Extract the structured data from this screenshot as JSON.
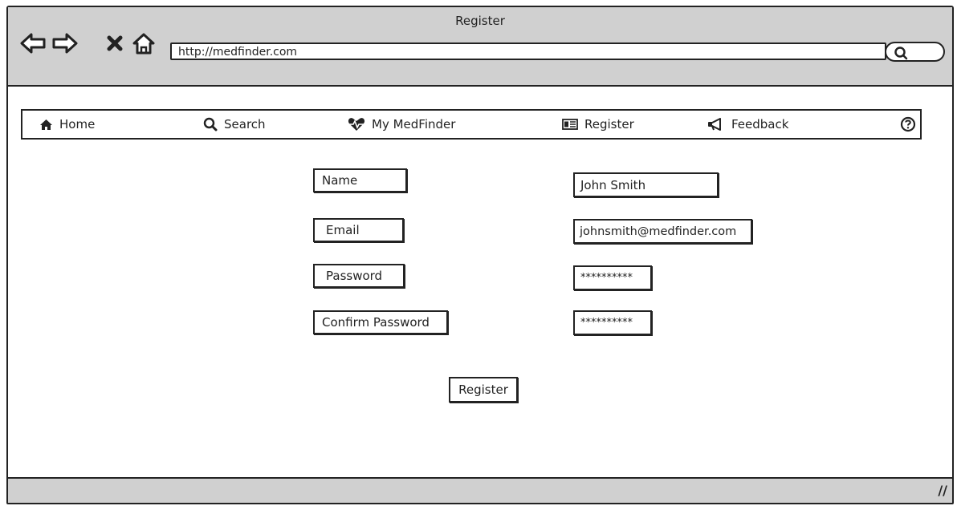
{
  "window": {
    "title": "Register"
  },
  "browser": {
    "url": "http://medfinder.com",
    "icons": [
      "back-arrow-icon",
      "forward-arrow-icon",
      "stop-icon",
      "home-icon",
      "search-icon"
    ]
  },
  "menu": {
    "items": [
      {
        "label": "Home",
        "icon": "home-icon"
      },
      {
        "label": "Search",
        "icon": "search-icon"
      },
      {
        "label": "My MedFinder",
        "icon": "heartbeat-icon"
      },
      {
        "label": "Register",
        "icon": "id-card-icon"
      },
      {
        "label": "Feedback",
        "icon": "megaphone-icon"
      }
    ],
    "help_icon": "help-icon"
  },
  "form": {
    "name_label": "Name",
    "email_label": "Email",
    "password_label": "Password",
    "confirm_label": "Confirm Password",
    "name_value": "John Smith",
    "email_value": "johnsmith@medfinder.com",
    "password_value": "**********",
    "confirm_value": "**********",
    "submit_label": "Register"
  },
  "statusbar": {
    "grip": "//"
  }
}
